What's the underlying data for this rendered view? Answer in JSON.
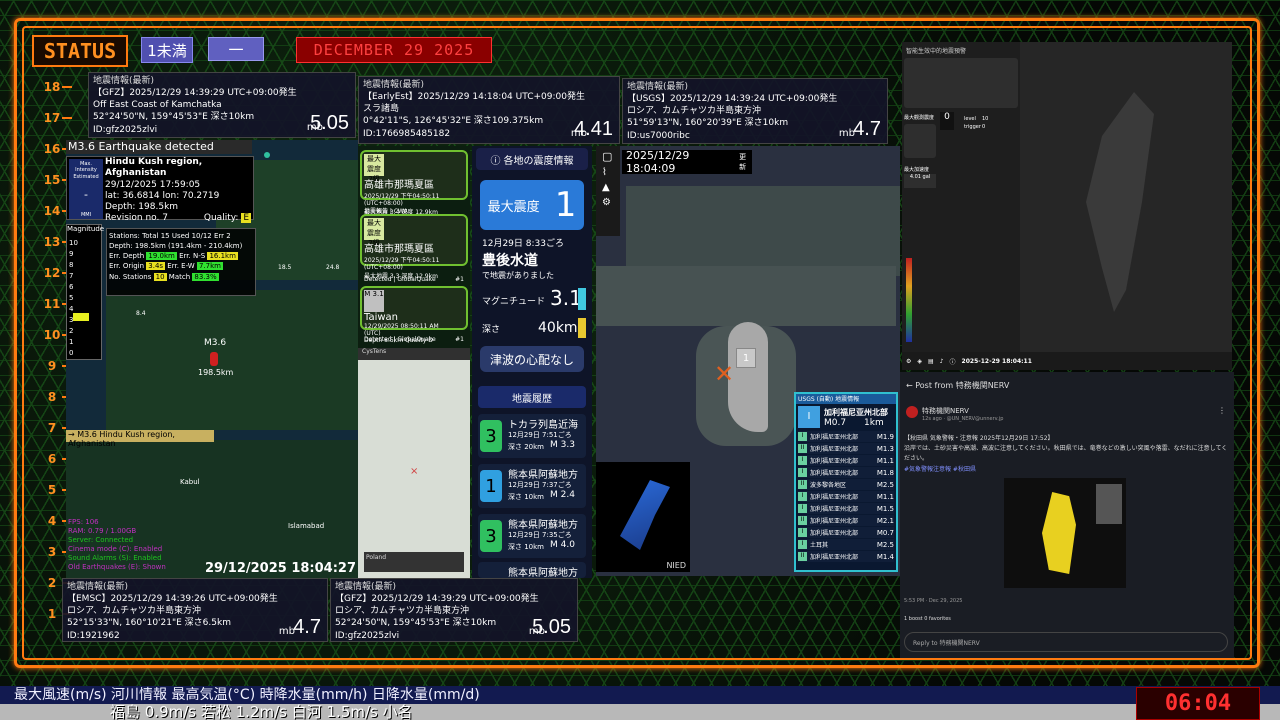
{
  "header": {
    "status_label": "STATUS",
    "tag1": "1未満",
    "tag2": "一",
    "date": "DECEMBER 29  2025"
  },
  "scale_numbers": [
    "18",
    "17",
    "16",
    "15",
    "14",
    "13",
    "12",
    "11",
    "10",
    "9",
    "8",
    "7",
    "6",
    "5",
    "4",
    "3",
    "2",
    "1"
  ],
  "eq_cards": [
    {
      "header": "地震情報(最新)",
      "line1": "【GFZ】2025/12/29  14:39:29  UTC+09:00発生",
      "line2": "Off East Coast of Kamchatka",
      "line3": "52°24'50\"N, 159°45'53\"E  深さ10km",
      "line4": "ID:gfz2025zlvi",
      "mb": "mb",
      "mag": "5.05"
    },
    {
      "header": "地震情報(最新)",
      "line1": "【EarlyEst】2025/12/29  14:18:04  UTC+09:00発生",
      "line2": "スラ諸島",
      "line3": "0°42'11\"S, 126°45'32\"E  深さ109.375km",
      "line4": "ID:1766985485182",
      "mb": "mb",
      "mag": "4.41"
    },
    {
      "header": "地震情報(最新)",
      "line1": "【USGS】2025/12/29  14:39:24  UTC+09:00発生",
      "line2": "ロシア、カムチャツカ半島東方沖",
      "line3": "51°59'13\"N, 160°20'39\"E  深さ10km",
      "line4": "ID:us7000ribc",
      "mb": "mb",
      "mag": "4.7"
    },
    {
      "header": "地震情報(最新)",
      "line1": "【EMSC】2025/12/29  14:39:26  UTC+09:00発生",
      "line2": "ロシア、カムチャツカ半島東方沖",
      "line3": "52°15'33\"N, 160°10'21\"E  深さ6.5km",
      "line4": "ID:1921962",
      "mb": "mb",
      "mag": "4.7"
    },
    {
      "header": "地震情報(最新)",
      "line1": "【GFZ】2025/12/29  14:39:29  UTC+09:00発生",
      "line2": "ロシア、カムチャツカ半島東方沖",
      "line3": "52°24'50\"N, 159°45'53\"E  深さ10km",
      "line4": "ID:gfz2025zlvi",
      "mb": "mb",
      "mag": "5.05"
    }
  ],
  "map1": {
    "title": "M3.6 Earthquake detected",
    "mi_label": "Max. Intensity Estimated",
    "mi_value": "-",
    "mi_scale": "MMI",
    "region": "Hindu Kush region, Afghanistan",
    "datetime": "29/12/2025 17:59:05",
    "latlon": "lat: 36.6814 lon: 70.2719",
    "depth": "Depth: 198.5km",
    "revision": "Revision no. 7",
    "quality_label": "Quality:",
    "quality": "E",
    "stats_line1": "Stations: Total 15 Used 10/12 Err 2",
    "stats_line2": "Depth: 198.5km (191.4km - 210.4km)",
    "err_depth_label": "Err. Depth",
    "err_depth": "19.0km",
    "err_ns_label": "Err. N-S",
    "err_ns": "16.1km",
    "err_origin_label": "Err. Origin",
    "err_origin": "3.4s",
    "err_ew_label": "Err. E-W",
    "err_ew": "7.7km",
    "no_stations_label": "No. Stations",
    "no_stations": "10",
    "match_label": "Match",
    "match": "83.3%",
    "magnitude_label": "Magnitude",
    "mag_scale": [
      "10",
      "9",
      "8",
      "7",
      "6",
      "5",
      "4",
      "3",
      "2",
      "1",
      "0"
    ],
    "marker_label": "M3.6",
    "marker_depth": "198.5km",
    "footer": "→ M3.6 Hindu Kush region, Afghanistan",
    "city1": "Kabul",
    "city2": "Islamabad",
    "dots": [
      "18.5",
      "24.8",
      "8.4",
      "13.5"
    ],
    "debug": [
      "FPS: 106",
      "RAM: 0.79 / 1.00GB",
      "Server: Connected",
      "Cinema mode (C): Enabled",
      "Sound Alarms (S): Enabled",
      "Old Earthquakes (E): Shown"
    ],
    "time": "29/12/2025 18:04:27"
  },
  "mid_left": {
    "card1": {
      "badge": "最大震度 2級",
      "title": "高雄市那瑪夏區",
      "sub": "2025/12/29 下午04:50:11 (UTC+08:00)",
      "detail": "最大地震 3.4  深度 12.9km"
    },
    "card2_head": "地震報告 | CWA",
    "card2": {
      "badge": "最大震度 2級",
      "title": "高雄市那瑪夏區",
      "sub": "2025/12/29 下午04:50:11 (UTC+08:00)",
      "detail": "最大地震 3.3  深度 12.9km"
    },
    "card3_head": "Detected | GlobalQuake",
    "card3_num": "#1",
    "card3": {
      "badge": "M 3.1",
      "title": "Taiwan",
      "sub": "12/29/2025 08:50:11 AM (UTC)",
      "detail": "Depth 8.5km  Quality D"
    },
    "card4_head": "Detected | GlobalQuake",
    "card4_num": "#1",
    "mini_title": "CysTens",
    "mini_foot": "Poland"
  },
  "jp": {
    "title": "各地の震度情報",
    "max_label": "最大震度",
    "max_value": "1",
    "time": "12月29日 8:33ごろ",
    "place": "豊後水道",
    "note": "で地震がありました",
    "mag_label": "マグニチュード",
    "mag_value": "3.1",
    "depth_label": "深さ",
    "depth_value": "40km",
    "tsunami": "津波の心配なし",
    "history_title": "地震履歴",
    "history": [
      {
        "int": "3",
        "place": "トカラ列島近海",
        "time": "12月29日 7:51ごろ",
        "depth": "深さ  20km",
        "mag": "M 3.3",
        "color": "#30c060"
      },
      {
        "int": "1",
        "place": "熊本県阿蘇地方",
        "time": "12月29日 7:37ごろ",
        "depth": "深さ  10km",
        "mag": "M 2.4",
        "color": "#30a0e0"
      },
      {
        "int": "3",
        "place": "熊本県阿蘇地方",
        "time": "12月29日 7:35ごろ",
        "depth": "深さ  10km",
        "mag": "M 4.0",
        "color": "#30c060"
      },
      {
        "int": "",
        "place": "熊本県阿蘇地方",
        "time": "",
        "depth": "",
        "mag": "",
        "color": "#30c060"
      }
    ]
  },
  "map2": {
    "time": "2025/12/29  18:04:09",
    "update": "更新",
    "intensity": "1",
    "nied": "NIED",
    "usgs_title": "USGS (自動) 地震情報",
    "usgs_place": "加利福尼亚州北部",
    "usgs_mag": "M0.7",
    "usgs_depth": "1km",
    "usgs_rows": [
      {
        "i": "I",
        "t": "加利福尼亚州北部",
        "m": "M1.9"
      },
      {
        "i": "II",
        "t": "加利福尼亚州北部",
        "m": "M1.3"
      },
      {
        "i": "I",
        "t": "加利福尼亚州北部",
        "m": "M1.1"
      },
      {
        "i": "I",
        "t": "加利福尼亚州北部",
        "m": "M1.8"
      },
      {
        "i": "II",
        "t": "波多黎各地区",
        "m": "M2.5"
      },
      {
        "i": "I",
        "t": "加利福尼亚州北部",
        "m": "M1.1"
      },
      {
        "i": "I",
        "t": "加利福尼亚州北部",
        "m": "M1.5"
      },
      {
        "i": "II",
        "t": "加利福尼亚州北部",
        "m": "M2.1"
      },
      {
        "i": "I",
        "t": "加利福尼亚州北部",
        "m": "M0.7"
      },
      {
        "i": "I",
        "t": "土耳其",
        "m": "M2.5"
      },
      {
        "i": "II",
        "t": "加利福尼亚州北部",
        "m": "M1.4"
      }
    ]
  },
  "taiwan": {
    "title": "智能生效中的地震預警",
    "label1": "最大觀測震度",
    "value1": "0",
    "label2": "最大加速度",
    "value2": "4.01 gal",
    "mini1": "level",
    "mini2": "trigger",
    "num1": "10",
    "num2": "0",
    "time": "2025-12-29 18:04:11"
  },
  "nerv": {
    "header": "Post from 特務機関NERV",
    "name": "特務機関NERV",
    "handle": "12s ago · @UN_NERV@unnerv.jp",
    "body1": "【秋田県 気象警報・注意報 2025年12月29日 17:52】",
    "body2": "沿岸では、土砂災害や高潮、高波に注意してください。秋田県では、竜巻などの激しい突風や落雷、なだれに注意してください。",
    "tags": "#気象警報注意報 #秋田県",
    "timestamp": "5:53 PM · Dec 29, 2025",
    "stats": "1 boost  0 favorites",
    "reply": "Reply to 特務機関NERV"
  },
  "ticker": {
    "line1": "最大風速(m/s) 河川情報   最高気温(°C)   時降水量(mm/h)   日降水量(mm/d)",
    "line2": "福島 0.9m/s   若松 1.2m/s   白河 1.5m/s   小名"
  },
  "clock": "06:04"
}
